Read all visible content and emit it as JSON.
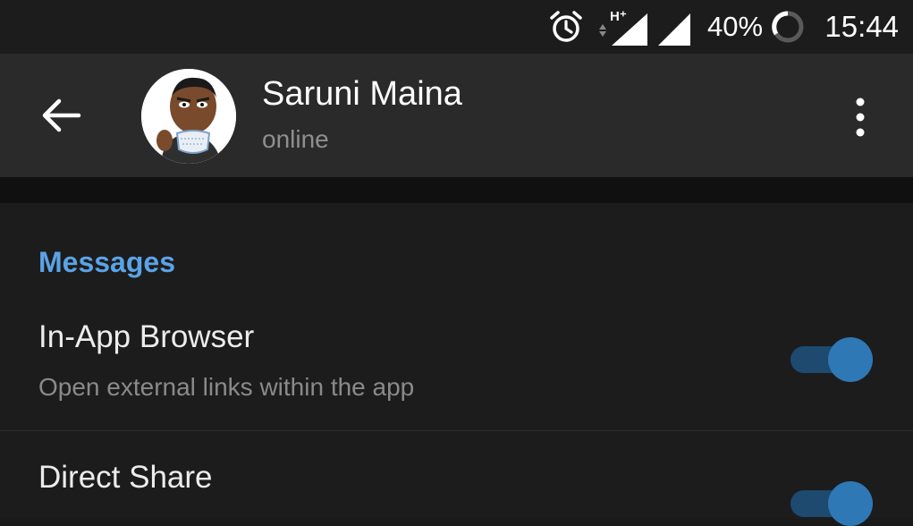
{
  "status_bar": {
    "icons": [
      "alarm-icon",
      "hplus-signal-icon",
      "cell-signal-icon",
      "battery-circle-icon"
    ],
    "battery": "40%",
    "time": "15:44"
  },
  "app_bar": {
    "contact_name": "Saruni Maina",
    "status": "online",
    "back_icon": "arrow-left-icon",
    "menu_icon": "more-vert-icon"
  },
  "settings": {
    "section_title": "Messages",
    "items": [
      {
        "title": "In-App Browser",
        "subtitle": "Open external links within the app",
        "enabled": true
      },
      {
        "title": "Direct Share",
        "subtitle": "",
        "enabled": true
      }
    ]
  },
  "colors": {
    "accent": "#5aa3e6",
    "toggle_knob": "#2e78b5",
    "toggle_track": "#1d4a6e",
    "background": "#1c1c1c",
    "app_bar": "#2a2a2a"
  }
}
